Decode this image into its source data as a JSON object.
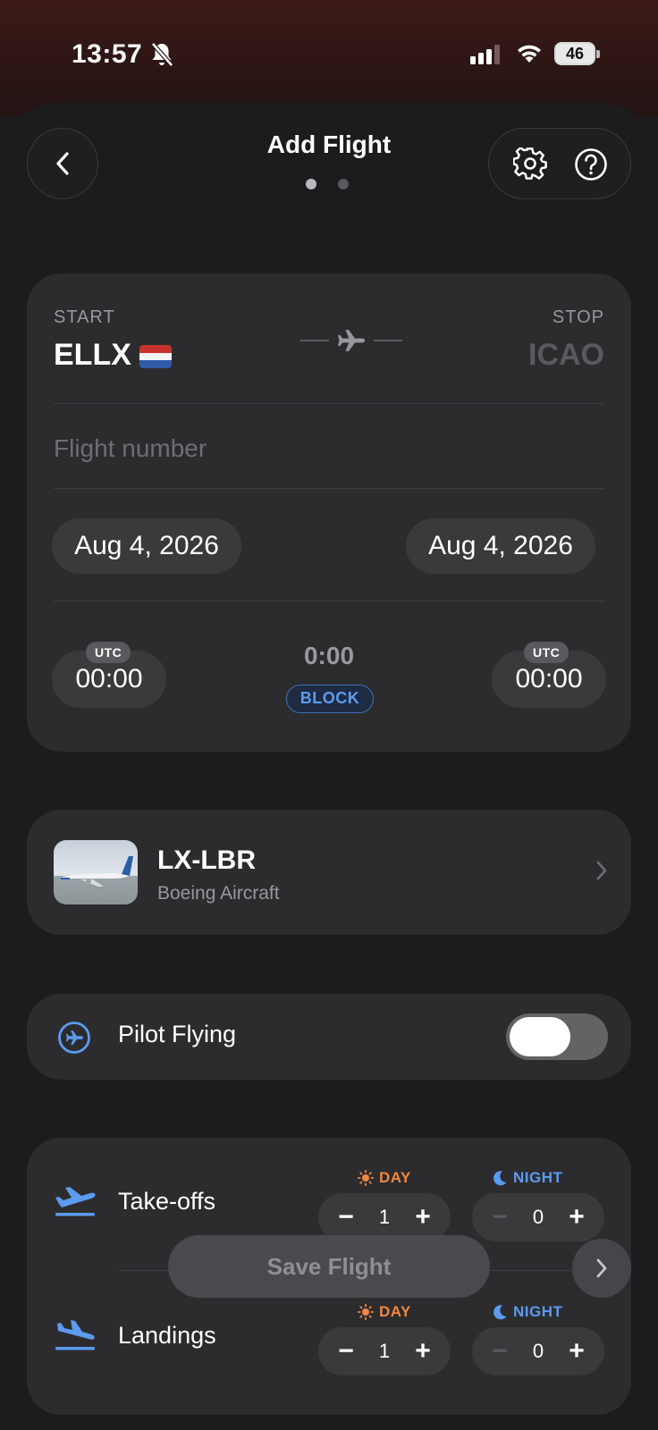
{
  "status_bar": {
    "time": "13:57",
    "battery": "46"
  },
  "nav": {
    "title": "Add Flight",
    "page_count": 2,
    "active_page": 0
  },
  "route": {
    "start_label": "START",
    "start_code": "ELLX",
    "stop_label": "STOP",
    "stop_placeholder": "ICAO",
    "flight_number_placeholder": "Flight number",
    "date_start": "Aug 4, 2026",
    "date_end": "Aug 4, 2026",
    "time_zone_label": "UTC",
    "time_start": "00:00",
    "time_end": "00:00",
    "block_time": "0:00",
    "block_label": "BLOCK"
  },
  "aircraft": {
    "registration": "LX-LBR",
    "type": "Boeing Aircraft"
  },
  "pilot_flying": {
    "label": "Pilot Flying",
    "enabled": true
  },
  "counts": {
    "day_label": "DAY",
    "night_label": "NIGHT",
    "takeoffs": {
      "label": "Take-offs",
      "day": "1",
      "night": "0"
    },
    "landings": {
      "label": "Landings",
      "day": "1",
      "night": "0"
    }
  },
  "footer": {
    "save_label": "Save Flight"
  },
  "colors": {
    "accent_blue": "#5b9bf0",
    "day_orange": "#f0883e",
    "card_bg": "#2c2c2e",
    "background": "#1c1c1e"
  }
}
